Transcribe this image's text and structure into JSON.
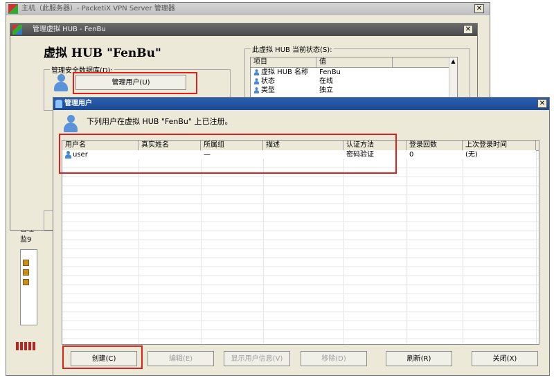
{
  "bg_window": {
    "title": "主机（此服务器）- PacketiX VPN Server 管理器",
    "left_labels": [
      "此\\",
      "管理",
      "监9",
      "隧"
    ]
  },
  "manage_hub_window": {
    "title": "管理虚拟 HUB - FenBu",
    "heading": "虚拟 HUB \"FenBu\"",
    "security_group_label": "管理安全数据库(D):",
    "manage_users_button": "管理用户(U)",
    "status_group_label": "此虚拟 HUB 当前状态(S):",
    "status_headers": [
      "项目",
      "值"
    ],
    "status_rows": [
      {
        "item": "虚拟 HUB 名称",
        "value": "FenBu"
      },
      {
        "item": "状态",
        "value": "在线"
      },
      {
        "item": "类型",
        "value": "独立"
      }
    ]
  },
  "manage_users_dialog": {
    "title": "管理用户",
    "description": "下列用户在虚拟 HUB \"FenBu\" 上已注册。",
    "columns": [
      "用户名",
      "真实姓名",
      "所属组",
      "描述",
      "认证方法",
      "登录回数",
      "上次登录时间"
    ],
    "rows": [
      {
        "username": "user",
        "realname": "",
        "group": "—",
        "description": "",
        "auth": "密码验证",
        "logins": "0",
        "last_login": "(无)"
      }
    ],
    "buttons": {
      "create": "创建(C)",
      "edit": "编辑(E)",
      "show_info": "显示用户信息(V)",
      "remove": "移除(D)",
      "refresh": "刷新(R)",
      "close": "关闭(X)"
    }
  },
  "colors": {
    "highlight_red": "#e0201b",
    "title_blue": "#1c4a95",
    "face": "#ece9d8"
  }
}
